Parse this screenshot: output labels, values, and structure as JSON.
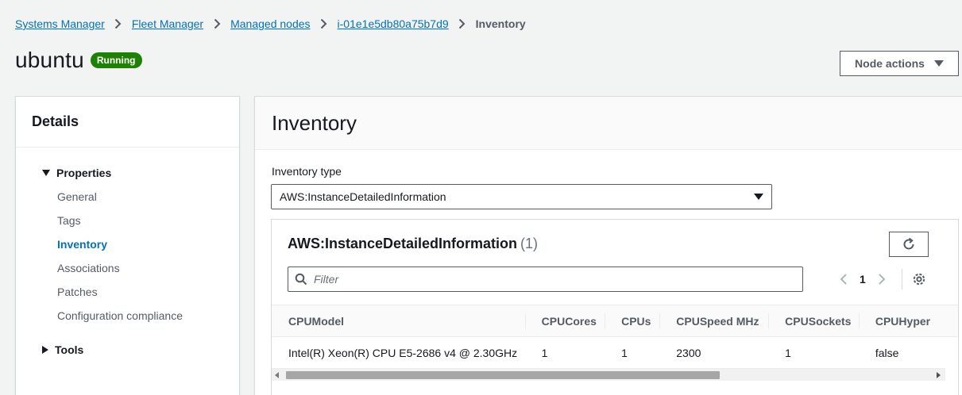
{
  "breadcrumb": {
    "items": [
      "Systems Manager",
      "Fleet Manager",
      "Managed nodes",
      "i-01e1e5db80a75b7d9"
    ],
    "current": "Inventory"
  },
  "header": {
    "title": "ubuntu",
    "status": "Running",
    "status_color": "#1d8102",
    "actions_label": "Node actions"
  },
  "sidebar": {
    "title": "Details",
    "sections": [
      {
        "label": "Properties",
        "expanded": true,
        "items": [
          {
            "label": "General",
            "active": false
          },
          {
            "label": "Tags",
            "active": false
          },
          {
            "label": "Inventory",
            "active": true
          },
          {
            "label": "Associations",
            "active": false
          },
          {
            "label": "Patches",
            "active": false
          },
          {
            "label": "Configuration compliance",
            "active": false
          }
        ]
      },
      {
        "label": "Tools",
        "expanded": false
      }
    ]
  },
  "main": {
    "title": "Inventory",
    "inventory_type_label": "Inventory type",
    "inventory_type_value": "AWS:InstanceDetailedInformation",
    "table": {
      "title": "AWS:InstanceDetailedInformation",
      "count": "(1)",
      "filter_placeholder": "Filter",
      "page": "1",
      "columns": [
        "CPUModel",
        "CPUCores",
        "CPUs",
        "CPUSpeed MHz",
        "CPUSockets",
        "CPUHyper"
      ],
      "rows": [
        [
          "Intel(R) Xeon(R) CPU E5-2686 v4 @ 2.30GHz",
          "1",
          "1",
          "2300",
          "1",
          "false"
        ]
      ]
    }
  },
  "colors": {
    "link": "#0073bb",
    "background": "#f2f3f3",
    "text": "#16191f"
  }
}
